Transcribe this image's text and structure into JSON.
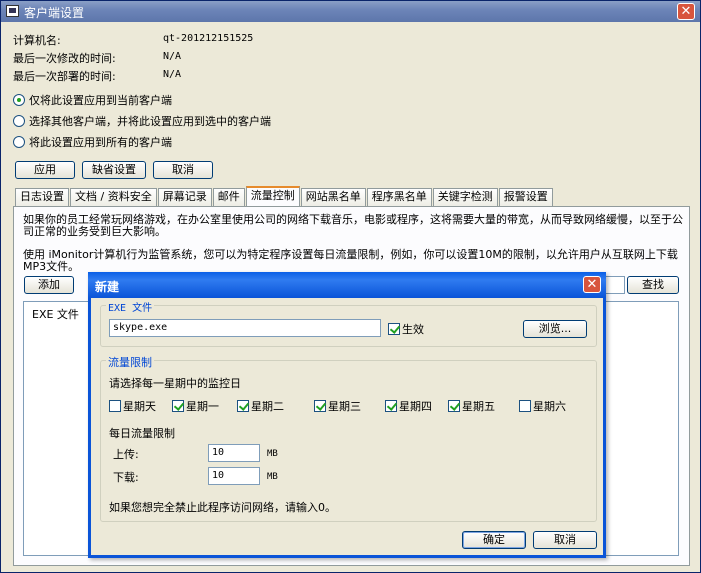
{
  "window": {
    "title": "客户端设置",
    "close_glyph": "✕"
  },
  "info": {
    "computer_name_label": "计算机名:",
    "computer_name_value": "qt-201212151525",
    "last_modified_label": "最后一次修改的时间:",
    "last_modified_value": "N/A",
    "last_deployed_label": "最后一次部署的时间:",
    "last_deployed_value": "N/A"
  },
  "scope": {
    "options": [
      "仅将此设置应用到当前客户端",
      "选择其他客户端，并将此设置应用到选中的客户端",
      "将此设置应用到所有的客户端"
    ],
    "selected_index": 0
  },
  "actions": {
    "apply": "应用",
    "default": "缺省设置",
    "cancel": "取消"
  },
  "tabs": [
    "日志设置",
    "文档 / 资料安全",
    "屏幕记录",
    "邮件",
    "流量控制",
    "网站黑名单",
    "程序黑名单",
    "关键字检测",
    "报警设置"
  ],
  "active_tab": 4,
  "panel": {
    "desc1": "如果你的员工经常玩网络游戏，在办公室里使用公司的网络下载音乐，电影或程序，这将需要大量的带宽，从而导致网络缓慢，以至于公司正常的业务受到巨大影响。",
    "desc2": "使用 iMonitor计算机行为监管系统，您可以为特定程序设置每日流量限制，例如，你可以设置10M的限制，以允许用户从互联网上下载MP3文件。",
    "add_button": "添加",
    "find_button": "查找",
    "list_column": "EXE 文件"
  },
  "dialog": {
    "title": "新建",
    "close_glyph": "✕",
    "exe_group_label": "EXE 文件",
    "exe_value": "skype.exe",
    "enabled_label": "生效",
    "enabled": true,
    "browse_button": "浏览...",
    "traffic_group_label": "流量限制",
    "weekday_prompt": "请选择每一星期中的监控日",
    "weekdays": [
      {
        "label": "星期天",
        "checked": false
      },
      {
        "label": "星期一",
        "checked": true
      },
      {
        "label": "星期二",
        "checked": true
      },
      {
        "label": "星期三",
        "checked": true
      },
      {
        "label": "星期四",
        "checked": true
      },
      {
        "label": "星期五",
        "checked": true
      },
      {
        "label": "星期六",
        "checked": false
      }
    ],
    "daily_limit_label": "每日流量限制",
    "upload_label": "上传:",
    "upload_value": "10",
    "download_label": "下载:",
    "download_value": "10",
    "unit": "MB",
    "hint": "如果您想完全禁止此程序访问网络，请输入0。",
    "ok_button": "确定",
    "cancel_button": "取消"
  }
}
